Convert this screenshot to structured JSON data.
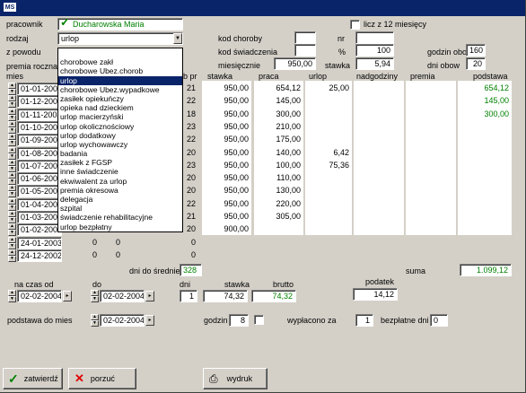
{
  "titlebar": {
    "icon_text": "MS"
  },
  "form": {
    "pracownik_label": "pracownik",
    "pracownik_value": "Ducharowska Maria",
    "rodzaj_label": "rodzaj",
    "rodzaj_value": "urlop",
    "z_powodu_label": "z powodu",
    "premia_roczna_label": "premia roczna",
    "kod_choroby_label": "kod choroby",
    "kod_choroby_value": "",
    "kod_swiadczenia_label": "kod świadczenia",
    "kod_swiadczenia_value": "",
    "miesiecznie_label": "miesięcznie",
    "miesiecznie_value": "950,00",
    "nr_label": "nr",
    "nr_value": "",
    "procent_label": "%",
    "procent_value": "100",
    "stawka_label": "stawka",
    "stawka_value": "5,94",
    "licz_label": "licz z 12 miesięcy",
    "godzin_obow_label": "godzin obow",
    "godzin_obow_value": "160",
    "dni_obow_label": "dni obow",
    "dni_obow_value": "20"
  },
  "dropdown": {
    "items": [
      "",
      "chorobowe zakł",
      "chorobowe Ubez.chorob",
      "urlop",
      "chorobowe Ubez.wypadkowe",
      "zasiłek opiekuńczy",
      "opieka nad dzieckiem",
      "urlop macierzyński",
      "urlop okolicznościowy",
      "urlop dodatkowy",
      "urlop wychowawczy",
      "badania",
      "zasiłek z FGSP",
      "inne świadczenie",
      "ekwiwalent za urlop",
      "premia okresowa",
      "delegacja",
      "szpital",
      "świadczenie rehabilitacyjne",
      "urlop bezpłatny"
    ],
    "selected_index": 3
  },
  "table": {
    "headers": {
      "mies": "mies",
      "dni_pr": "b pr",
      "stawka": "stawka",
      "praca": "praca",
      "urlop": "urlop",
      "nadgodziny": "nadgodziny",
      "premia": "premia",
      "podstawa": "podstawa"
    },
    "rows": [
      {
        "mies": "01-01-2004",
        "dni": "21",
        "stawka": "950,00",
        "praca": "654,12",
        "urlop": "25,00",
        "nadgodziny": "",
        "premia": "",
        "podstawa": "654,12"
      },
      {
        "mies": "01-12-2003",
        "dni": "22",
        "stawka": "950,00",
        "praca": "145,00",
        "urlop": "",
        "nadgodziny": "",
        "premia": "",
        "podstawa": "145,00"
      },
      {
        "mies": "01-11-2003",
        "dni": "18",
        "stawka": "950,00",
        "praca": "300,00",
        "urlop": "",
        "nadgodziny": "",
        "premia": "",
        "podstawa": "300,00"
      },
      {
        "mies": "01-10-2003",
        "dni": "23",
        "stawka": "950,00",
        "praca": "210,00",
        "urlop": "",
        "nadgodziny": "",
        "premia": "",
        "podstawa": ""
      },
      {
        "mies": "01-09-2003",
        "dni": "22",
        "stawka": "950,00",
        "praca": "175,00",
        "urlop": "",
        "nadgodziny": "",
        "premia": "",
        "podstawa": ""
      },
      {
        "mies": "01-08-2003",
        "dni": "20",
        "stawka": "950,00",
        "praca": "140,00",
        "urlop": "6,42",
        "nadgodziny": "",
        "premia": "",
        "podstawa": ""
      },
      {
        "mies": "01-07-2003",
        "dni": "23",
        "stawka": "950,00",
        "praca": "100,00",
        "urlop": "75,36",
        "nadgodziny": "",
        "premia": "",
        "podstawa": ""
      },
      {
        "mies": "01-06-2003",
        "dni": "20",
        "stawka": "950,00",
        "praca": "110,00",
        "urlop": "",
        "nadgodziny": "",
        "premia": "",
        "podstawa": ""
      },
      {
        "mies": "01-05-2003",
        "dni": "20",
        "stawka": "950,00",
        "praca": "130,00",
        "urlop": "",
        "nadgodziny": "",
        "premia": "",
        "podstawa": ""
      },
      {
        "mies": "01-04-2003",
        "dni": "22",
        "stawka": "950,00",
        "praca": "220,00",
        "urlop": "",
        "nadgodziny": "",
        "premia": "",
        "podstawa": ""
      },
      {
        "mies": "01-03-2003",
        "dni": "21",
        "stawka": "950,00",
        "praca": "305,00",
        "urlop": "",
        "nadgodziny": "",
        "premia": "",
        "podstawa": ""
      },
      {
        "mies": "01-02-2003",
        "dni": "20",
        "stawka": "900,00",
        "praca": "",
        "urlop": "",
        "nadgodziny": "",
        "premia": "",
        "podstawa": ""
      },
      {
        "mies": "24-01-2003",
        "dni": "0",
        "z1": "0",
        "z2": "0"
      },
      {
        "mies": "24-12-2002",
        "dni": "0",
        "z1": "0",
        "z2": "0"
      }
    ],
    "dni_do_sredniej_label": "dni do średniej",
    "dni_do_sredniej_value": "328",
    "suma_label": "suma",
    "suma_value": "1.099,12"
  },
  "calc": {
    "na_czas_od_label": "na czas od",
    "na_czas_od_value": "02-02-2004",
    "do_label": "do",
    "do_value": "02-02-2004",
    "dni_label": "dni",
    "dni_value": "1",
    "stawka_label": "stawka",
    "stawka_value": "74,32",
    "brutto_label": "brutto",
    "brutto_value": "74,32",
    "podatek_label": "podatek",
    "podatek_value": "14,12",
    "podstawa_do_mies_label": "podstawa do mies",
    "podstawa_do_mies_value": "02-02-2004",
    "godzin_label": "godzin",
    "godzin_value": "8",
    "wyplacono_label": "wypłacono za",
    "wyplacono_value": "1",
    "bezplatne_label": "bezpłatne dni",
    "bezplatne_value": "0"
  },
  "buttons": {
    "zatwierdz": "zatwierdź",
    "porzuc": "porzuć",
    "wydruk": "wydruk"
  },
  "colors": {
    "titlebar": "#0a246a",
    "green_value": "#008000",
    "selection": "#0a246a"
  }
}
